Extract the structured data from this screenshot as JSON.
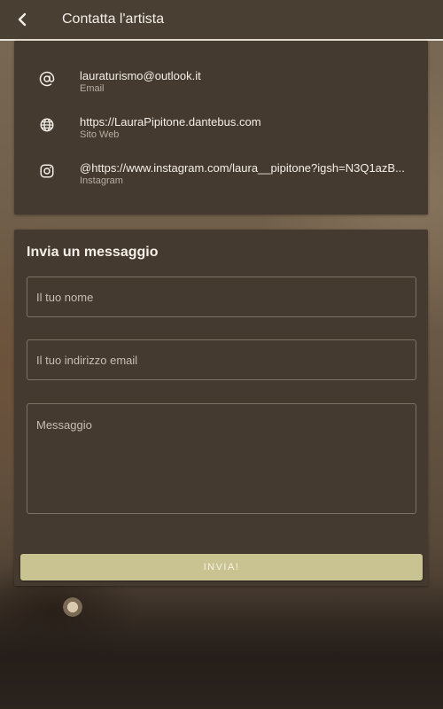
{
  "app_bar": {
    "title": "Contatta l'artista",
    "back_icon": "chevron-left-icon"
  },
  "contacts": [
    {
      "icon": "at-sign-icon",
      "value": "lauraturismo@outlook.it",
      "label": "Email"
    },
    {
      "icon": "globe-icon",
      "value": "https://LauraPipitone.dantebus.com",
      "label": "Sito Web"
    },
    {
      "icon": "instagram-icon",
      "value": "@https://www.instagram.com/laura__pipitone?igsh=N3Q1azB...",
      "label": "Instagram"
    }
  ],
  "form": {
    "title": "Invia un messaggio",
    "name_placeholder": "Il tuo nome",
    "email_placeholder": "Il tuo indirizzo email",
    "message_placeholder": "Messaggio",
    "submit_label": "INVIA!"
  },
  "colors": {
    "card_background": "#453a2f",
    "submit_button": "#c9c391",
    "app_bar": "#4a3f33"
  }
}
